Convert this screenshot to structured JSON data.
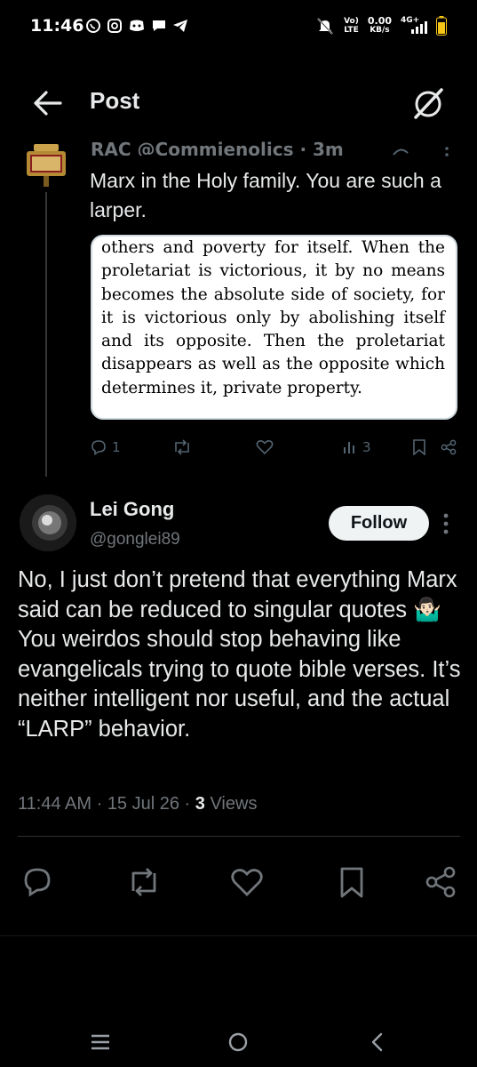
{
  "status_bar": {
    "time": "11:46",
    "volte": "Vo)",
    "lte": "LTE",
    "speed_value": "0.00",
    "speed_unit": "KB/s",
    "network": "4G+"
  },
  "header": {
    "title": "Post"
  },
  "parent_tweet": {
    "header_partial": "RAC @Commienolics · 3m",
    "text": "Marx in the Holy family. You are such a larper.",
    "quote_image_text": "others and poverty for itself. When the proletariat is victorious, it by no means becomes the absolute side of society, for it is victorious only by abolishing itself and its opposite. Then the proletariat disappears as well as the opposite which determines it, private property.",
    "replies": "1",
    "views": "3"
  },
  "tweet": {
    "author_name": "Lei Gong",
    "author_handle": "@gonglei89",
    "follow_label": "Follow",
    "body": "No, I just don’t pretend that everything Marx said can be reduced to singular quotes 🤷🏻‍♂️ You weirdos should stop behaving like evangelicals trying to quote bible verses. It’s neither intelligent nor useful, and the actual “LARP” behavior.",
    "time": "11:44 AM",
    "date": "15 Jul 26",
    "views_count": "3",
    "views_label": "Views"
  },
  "colors": {
    "background": "#000000",
    "text_primary": "#e7e9ea",
    "text_secondary": "#71767b",
    "icon_muted": "#536471"
  }
}
